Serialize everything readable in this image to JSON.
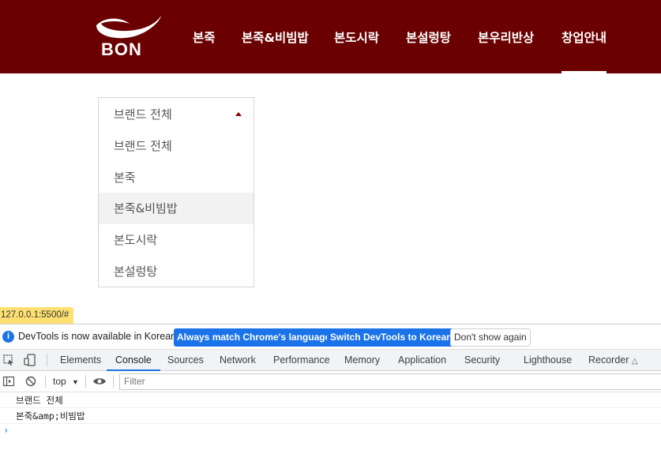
{
  "header": {
    "logo_text": "BON",
    "nav": [
      "본죽",
      "본죽&비빔밥",
      "본도시락",
      "본설렁탕",
      "본우리반상",
      "창업안내"
    ],
    "active_nav_index": 5,
    "bg_color": "#6b0000"
  },
  "dropdown": {
    "selected": "브랜드 전체",
    "options": [
      "브랜드 전체",
      "본죽",
      "본죽&비빔밥",
      "본도시락",
      "본설렁탕"
    ],
    "hovered_index": 2
  },
  "status_url": "127.0.0.1:5500/#",
  "devtools": {
    "infobar": {
      "message": "DevTools is now available in Korean!",
      "btn_match": "Always match Chrome's language",
      "btn_switch": "Switch DevTools to Korean",
      "btn_dismiss": "Don't show again"
    },
    "tabs": [
      "Elements",
      "Console",
      "Sources",
      "Network",
      "Performance",
      "Memory",
      "Application",
      "Security",
      "Lighthouse",
      "Recorder"
    ],
    "active_tab": "Console",
    "context": "top",
    "filter_placeholder": "Filter",
    "logs": [
      "브랜드 전체",
      "본죽&amp;비빔밥"
    ],
    "prompt_symbol": "›"
  }
}
